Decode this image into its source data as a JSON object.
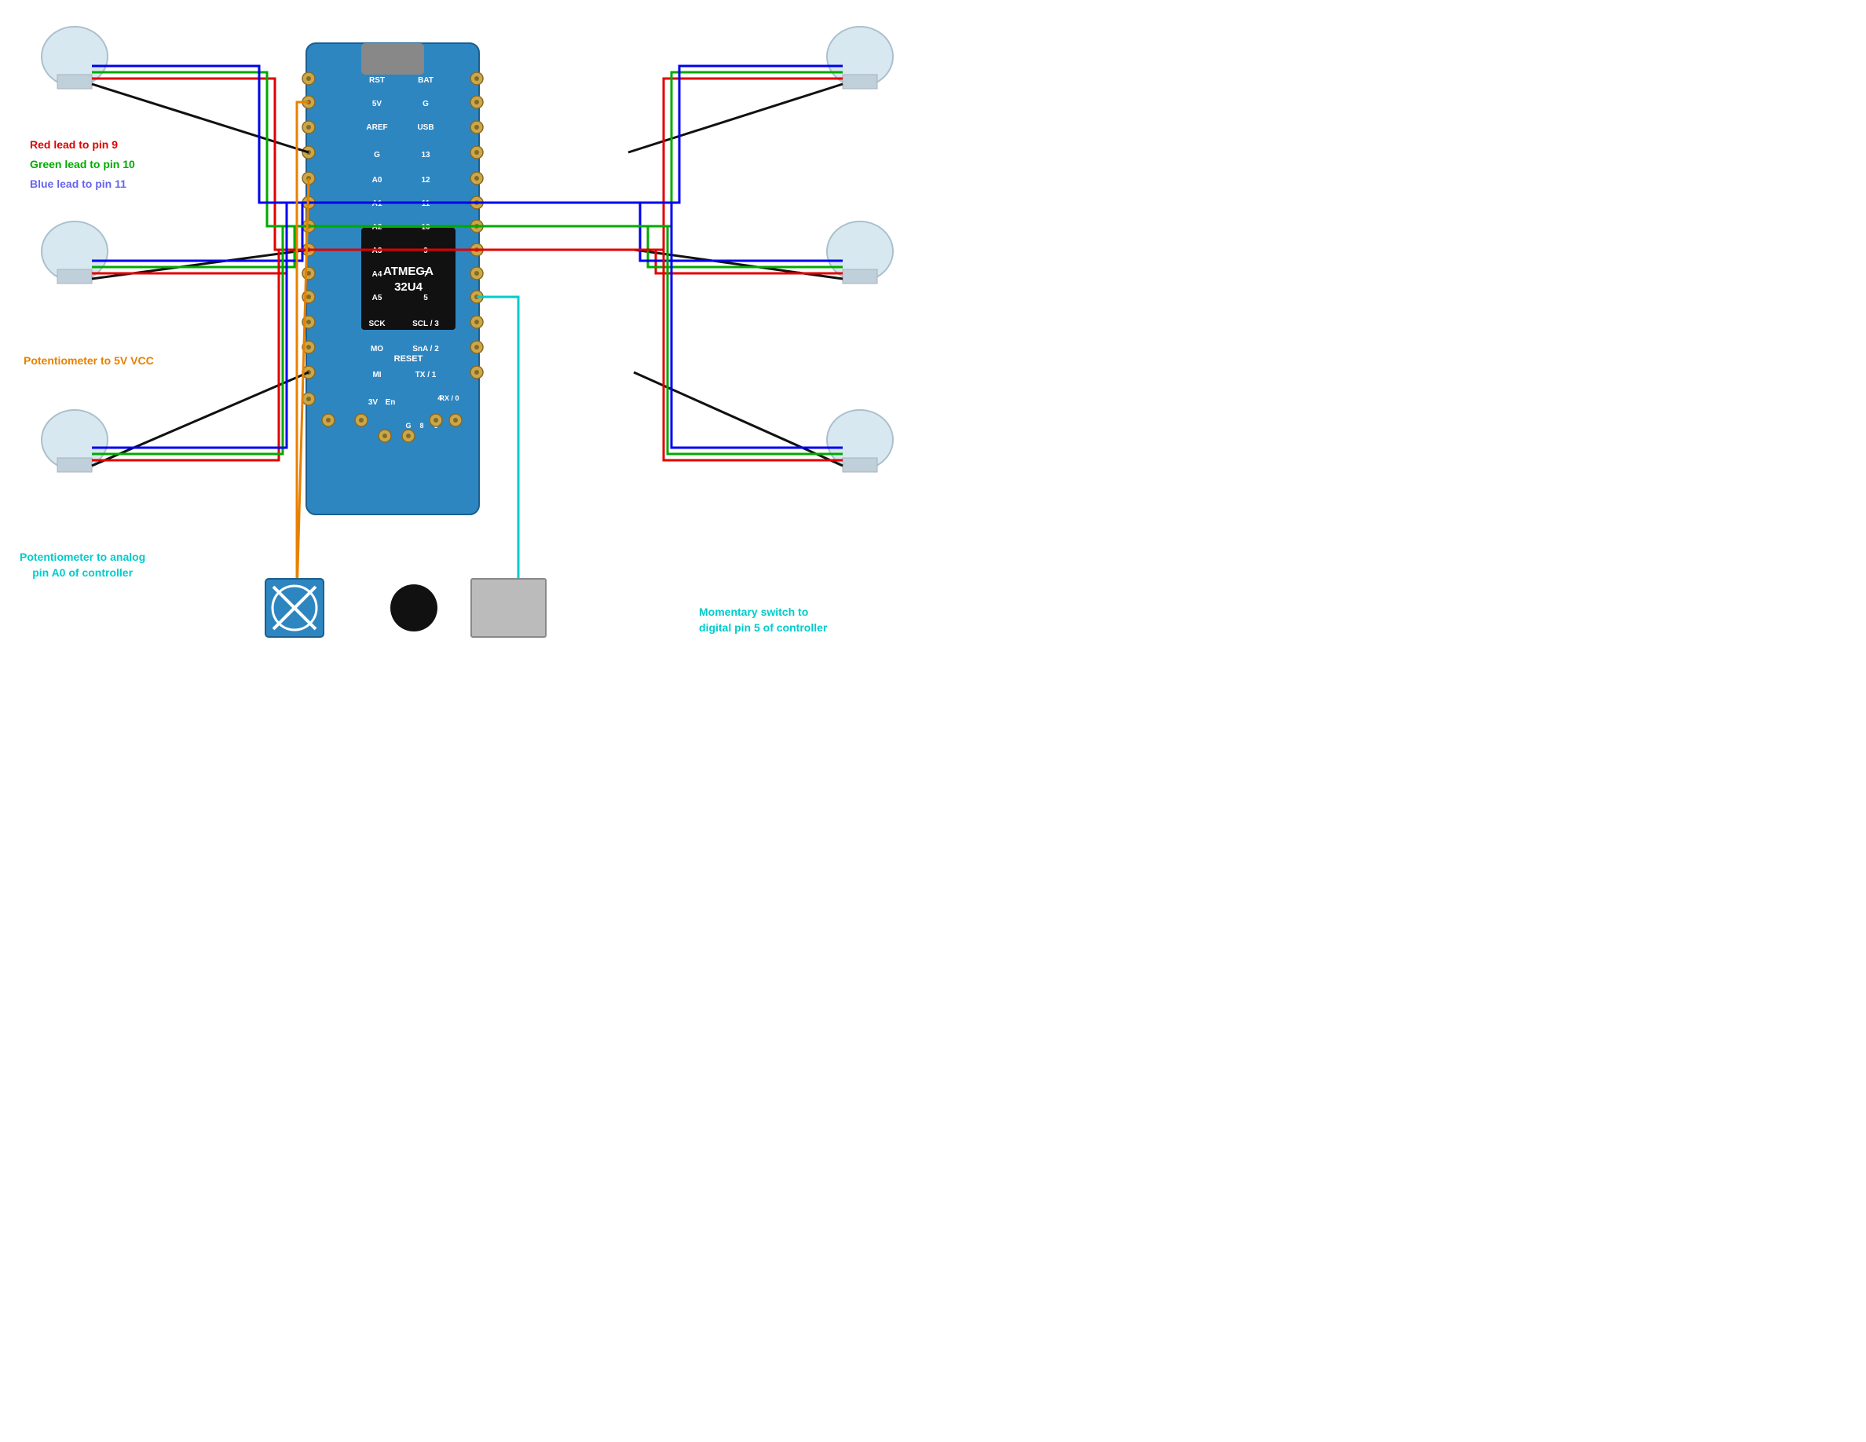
{
  "labels": {
    "red_lead": "Red lead to pin 9",
    "green_lead": "Green lead to pin 10",
    "blue_lead": "Blue lead to pin 11",
    "pot_vcc": "Potentiometer to 5V VCC",
    "pot_analog": "Potentiometer to analog\npin A0 of controller",
    "switch_digital": "Momentary switch to\ndigital pin 5 of controller"
  },
  "board": {
    "chip": "ATMEGA\n32U4",
    "pins_left": [
      "RST",
      "5V",
      "AREF",
      "G",
      "A0",
      "A1",
      "A2",
      "A3",
      "A4",
      "A5",
      "SCK",
      "MO",
      "MI",
      "3V",
      "En"
    ],
    "pins_right": [
      "BAT",
      "G",
      "USB",
      "13",
      "12",
      "11",
      "10",
      "9",
      "7",
      "5",
      "SCL/3",
      "SnA/2",
      "TX/1",
      "4",
      "RX/0",
      "6",
      "8",
      "G"
    ],
    "reset_label": "RESET"
  },
  "colors": {
    "red": "#e00000",
    "green": "#00aa00",
    "blue": "#0000ee",
    "black": "#111111",
    "orange": "#e88000",
    "cyan": "#00cccc",
    "board_bg": "#2e86c1",
    "pin_gold": "#c8a84b"
  }
}
